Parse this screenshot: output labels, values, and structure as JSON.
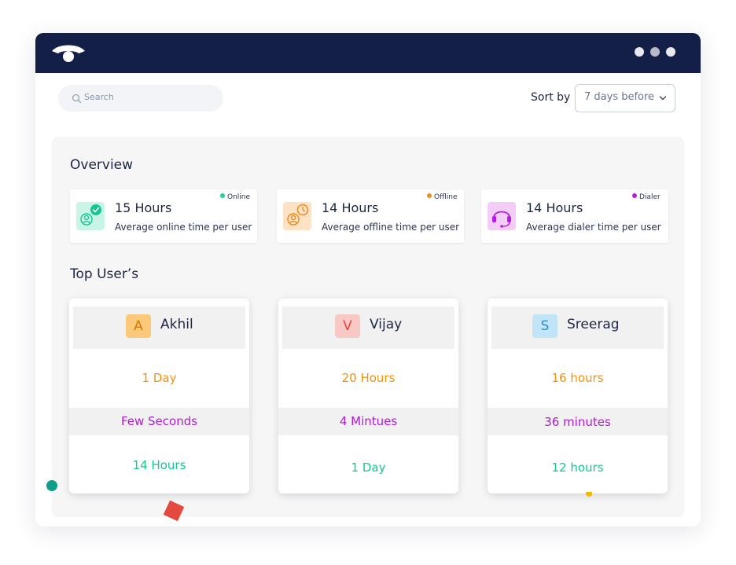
{
  "window": {
    "titlebar_color": "#141f47",
    "logo_icon": "phone-handset-icon",
    "window_dots": [
      "#e8e9ee",
      "#b7bac6",
      "#e8e9ee"
    ]
  },
  "toolbar": {
    "search_placeholder": "Search",
    "sort_label": "Sort by",
    "sort_value": "7 days before"
  },
  "overview": {
    "title": "Overview",
    "cards": [
      {
        "value": "15 Hours",
        "description": "Average online time per user",
        "badge": "Online",
        "badge_color": "#1ed09c",
        "icon": "user-online-icon"
      },
      {
        "value": "14 Hours",
        "description": "Average offline time per user",
        "badge": "Offline",
        "badge_color": "#f58a1f",
        "icon": "user-clock-icon"
      },
      {
        "value": "14 Hours",
        "description": "Average dialer time per user",
        "badge": "Dialer",
        "badge_color": "#b41fdc",
        "icon": "headset-icon"
      }
    ]
  },
  "top_users": {
    "title": "Top User’s",
    "users": [
      {
        "initial": "A",
        "name": "Akhil",
        "online": "1 Day",
        "offline": "Few Seconds",
        "dialer": "14 Hours"
      },
      {
        "initial": "V",
        "name": "Vijay",
        "online": "20 Hours",
        "offline": "4 Mintues",
        "dialer": "1 Day"
      },
      {
        "initial": "S",
        "name": "Sreerag",
        "online": "16 hours",
        "offline": "36 minutes",
        "dialer": "12 hours"
      }
    ]
  },
  "colors": {
    "online": "#f4920f",
    "offline": "#b21bd0",
    "dialer": "#13c795"
  }
}
